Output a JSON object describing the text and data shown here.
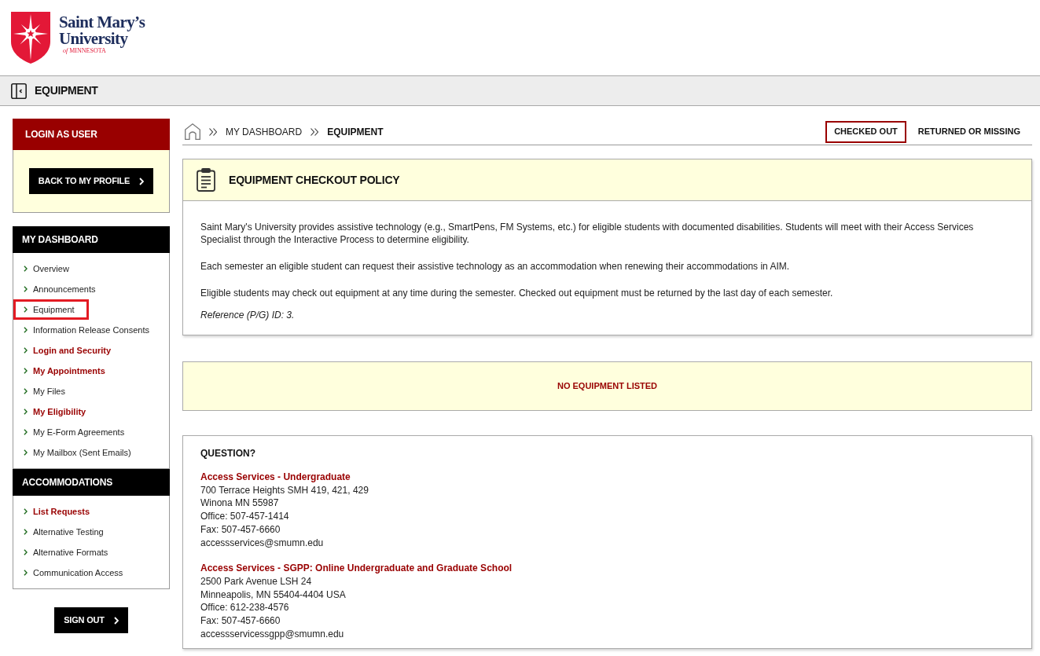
{
  "logo": {
    "name_line_1": "Saint Mary’s",
    "name_line_2": "University",
    "tagline": "*of* MINNESOTA"
  },
  "page_header": {
    "title": "EQUIPMENT"
  },
  "sidebar": {
    "login_as_user": {
      "title": "LOGIN AS USER",
      "button": "BACK TO MY PROFILE"
    },
    "sections": [
      {
        "title": "MY DASHBOARD",
        "items": [
          {
            "label": "Overview",
            "emphasized": false,
            "selected": false
          },
          {
            "label": "Announcements",
            "emphasized": false,
            "selected": false
          },
          {
            "label": "Equipment",
            "emphasized": false,
            "selected": true
          },
          {
            "label": "Information Release Consents",
            "emphasized": false,
            "selected": false
          },
          {
            "label": "Login and Security",
            "emphasized": true,
            "selected": false
          },
          {
            "label": "My Appointments",
            "emphasized": true,
            "selected": false
          },
          {
            "label": "My Files",
            "emphasized": false,
            "selected": false
          },
          {
            "label": "My Eligibility",
            "emphasized": true,
            "selected": false
          },
          {
            "label": "My E-Form Agreements",
            "emphasized": false,
            "selected": false
          },
          {
            "label": "My Mailbox (Sent Emails)",
            "emphasized": false,
            "selected": false
          }
        ]
      },
      {
        "title": "ACCOMMODATIONS",
        "items": [
          {
            "label": "List Requests",
            "emphasized": true,
            "selected": false
          },
          {
            "label": "Alternative Testing",
            "emphasized": false,
            "selected": false
          },
          {
            "label": "Alternative Formats",
            "emphasized": false,
            "selected": false
          },
          {
            "label": "Communication Access",
            "emphasized": false,
            "selected": false
          }
        ]
      }
    ],
    "sign_out": "SIGN OUT"
  },
  "breadcrumb": [
    {
      "label": "MY DASHBOARD",
      "current": false
    },
    {
      "label": "EQUIPMENT",
      "current": true
    }
  ],
  "tabs": [
    {
      "label": "CHECKED OUT",
      "selected": true
    },
    {
      "label": "RETURNED OR MISSING",
      "selected": false
    }
  ],
  "policy": {
    "title": "EQUIPMENT CHECKOUT POLICY",
    "paragraphs": [
      "Saint Mary's University provides assistive technology (e.g., SmartPens, FM Systems, etc.) for eligible students with documented disabilities. Students will meet with their Access Services Specialist through the Interactive Process to determine eligibility.",
      "Each semester an eligible student can request their assistive technology as an accommodation when renewing their accommodations in AIM.",
      "Eligible students may check out equipment at any time during the semester. Checked out equipment must be returned by the last day of each semester."
    ],
    "reference": "Reference (P/G) ID: 3."
  },
  "empty_notice": "NO EQUIPMENT LISTED",
  "question": {
    "title": "QUESTION?",
    "contacts": [
      {
        "name": "Access Services - Undergraduate",
        "lines": [
          "700 Terrace Heights SMH 419, 421, 429",
          "Winona MN 55987",
          "Office: 507-457-1414",
          "Fax: 507-457-6660",
          "accessservices@smumn.edu"
        ]
      },
      {
        "name": "Access Services - SGPP: Online Undergraduate and Graduate School",
        "lines": [
          "2500 Park Avenue LSH 24",
          "Minneapolis, MN 55404-4404 USA",
          "Office: 612-238-4576",
          "Fax: 507-457-6660",
          "accessservicessgpp@smumn.edu"
        ]
      }
    ]
  }
}
